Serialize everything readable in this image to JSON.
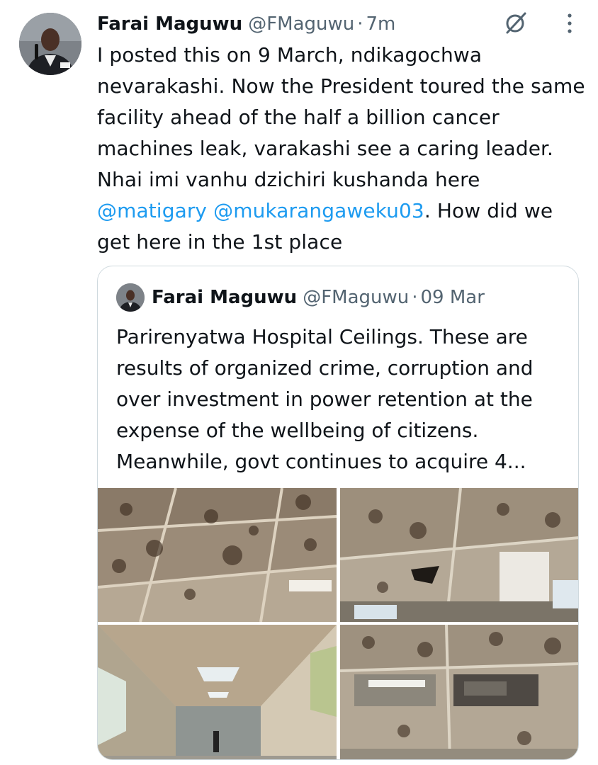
{
  "tweet": {
    "author_name": "Farai Maguwu",
    "handle": "@FMaguwu",
    "separator": "·",
    "time": "7m",
    "text_before": "I posted this on 9 March, ndikagochwa nevarakashi. Now the President toured the same facility ahead of the half a billion cancer machines leak, varakashi see a caring leader. Nhai imi vanhu dzichiri kushanda here ",
    "mention_1": "@matigary",
    "mention_space": " ",
    "mention_2": "@mukarangaweku03",
    "text_after": ". How did we get here in the 1st place",
    "icons": [
      "grok-icon",
      "more-icon"
    ]
  },
  "quoted_tweet": {
    "author_name": "Farai Maguwu",
    "handle": "@FMaguwu",
    "separator": "·",
    "date": "09 Mar",
    "text": "Parirenyatwa Hospital Ceilings. These are results of organized crime, corruption and over investment in power retention at the expense of the wellbeing of citizens. Meanwhile, govt continues to acquire 4...",
    "photos": [
      "ceiling-photo-1",
      "ceiling-photo-2",
      "corridor-ceiling-photo-3",
      "ceiling-photo-4"
    ]
  },
  "colors": {
    "text": "#0f1419",
    "secondary": "#536471",
    "link": "#1d9bf0",
    "border": "#cfd9de"
  }
}
